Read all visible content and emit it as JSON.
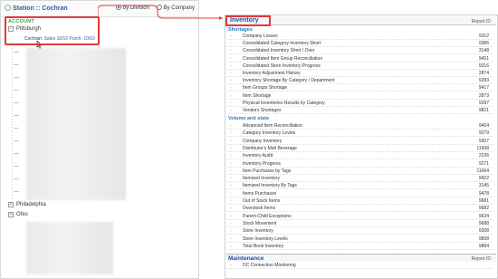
{
  "left": {
    "title": "Station :: Cochran",
    "radio_division": "by Division",
    "radio_company": "By Company",
    "account_label": "ACCOUNT",
    "node_pittsburgh": "Pittsburgh",
    "sub_name": "Cochran:",
    "sub_tags": "Sales 10/10 Purch. 10/10",
    "node_philadelphia": "Philadelphia",
    "node_ohio": "Ohio",
    "toggle_expanded": "−",
    "toggle_collapsed": "+"
  },
  "right": {
    "title": "Inventory",
    "report_id_label": "Report ID",
    "shortages_section": "Shortages",
    "volume_section": "Volume and state",
    "maintenance_title": "Maintenance",
    "maintenance_report_id": "Report ID",
    "shortages": [
      {
        "name": "Company Losses",
        "id": "9312"
      },
      {
        "name": "Consolidated Category Inventory Short",
        "id": "9386"
      },
      {
        "name": "Consolidated Inventory Short / Over",
        "id": "3148"
      },
      {
        "name": "Consolidated Item Group Reconciliation",
        "id": "9451"
      },
      {
        "name": "Consolidated Store Inventory Progress",
        "id": "9316"
      },
      {
        "name": "Inventory Adjustment History",
        "id": "2874"
      },
      {
        "name": "Inventory Shortage By Category / Department",
        "id": "9283"
      },
      {
        "name": "Item Groups Shortage",
        "id": "9417"
      },
      {
        "name": "Item Shortage",
        "id": "2873"
      },
      {
        "name": "Physical Inventories Results by Category",
        "id": "9287"
      },
      {
        "name": "Vendors Shortages",
        "id": "9821"
      }
    ],
    "volume": [
      {
        "name": "Advanced Item Reconciliation",
        "id": "9454"
      },
      {
        "name": "Category Inventory Levels",
        "id": "9279"
      },
      {
        "name": "Company Inventory",
        "id": "9307"
      },
      {
        "name": "Distributor's Malt Beverage",
        "id": "11668"
      },
      {
        "name": "Inventory Audit",
        "id": "2236"
      },
      {
        "name": "Inventory Progress",
        "id": "9271"
      },
      {
        "name": "Item Purchases by Tags",
        "id": "11664"
      },
      {
        "name": "Itemized Inventory",
        "id": "9422"
      },
      {
        "name": "Itemized Inventory By Tags",
        "id": "3145"
      },
      {
        "name": "Items Purchases",
        "id": "9478"
      },
      {
        "name": "Out of Stock Items",
        "id": "9681"
      },
      {
        "name": "Overstock Items",
        "id": "9682"
      },
      {
        "name": "Parent-Child Exceptions",
        "id": "9634"
      },
      {
        "name": "Stock Movement",
        "id": "9688"
      },
      {
        "name": "Store Inventory",
        "id": "9308"
      },
      {
        "name": "Store Inventory Levels",
        "id": "9858"
      },
      {
        "name": "Total Book Inventory",
        "id": "9884"
      }
    ],
    "maintenance": [
      {
        "name": "DC Connection Monitoring",
        "id": ""
      }
    ]
  },
  "colors": {
    "highlight": "#e03a3a",
    "link": "#2b5fa8",
    "section": "#2b7bbf",
    "account": "#4a9a3c"
  }
}
